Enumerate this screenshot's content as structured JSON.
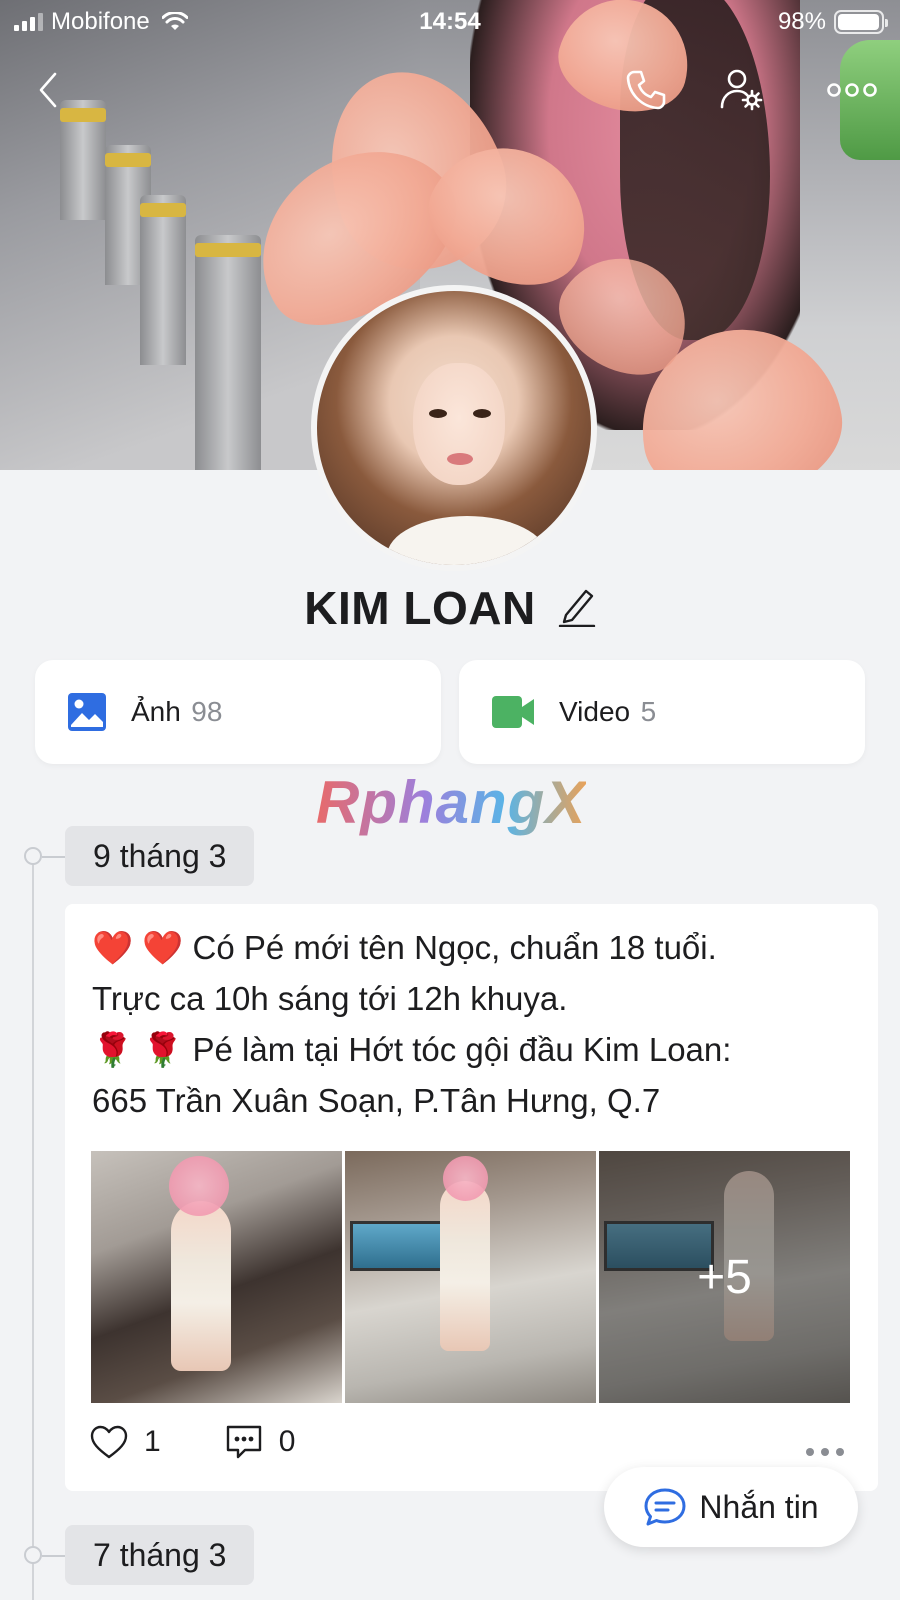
{
  "status_bar": {
    "carrier": "Mobifone",
    "time": "14:54",
    "battery": "98%",
    "battery_level": 0.98
  },
  "header": {
    "back_icon": "chevron-left-icon",
    "call_icon": "phone-icon",
    "settings_icon": "user-settings-icon",
    "more_icon": "more-horizontal-icon"
  },
  "profile": {
    "name": "KIM LOAN"
  },
  "media": {
    "photos": {
      "label": "Ảnh",
      "count": "98",
      "icon": "image-icon",
      "color": "#2f6de1"
    },
    "videos": {
      "label": "Video",
      "count": "5",
      "icon": "video-camera-icon",
      "color": "#4cb263"
    }
  },
  "watermark": "RphangX",
  "timeline": [
    {
      "date": "9 tháng 3",
      "post": {
        "lines": [
          "❤️ ❤️ Có Pé mới tên Ngọc, chuẩn 18 tuổi.",
          "Trực ca 10h sáng  tới 12h khuya.",
          "🌹 🌹 Pé làm tại Hớt tóc gội đầu Kim Loan:",
          "665 Trần Xuân Soạn, P.Tân Hưng, Q.7"
        ],
        "extra_photos": "+5",
        "likes": "1",
        "comments": "0"
      }
    },
    {
      "date": "7 tháng 3"
    }
  ],
  "fab": {
    "label": "Nhắn tin",
    "icon": "chat-bubble-icon"
  }
}
